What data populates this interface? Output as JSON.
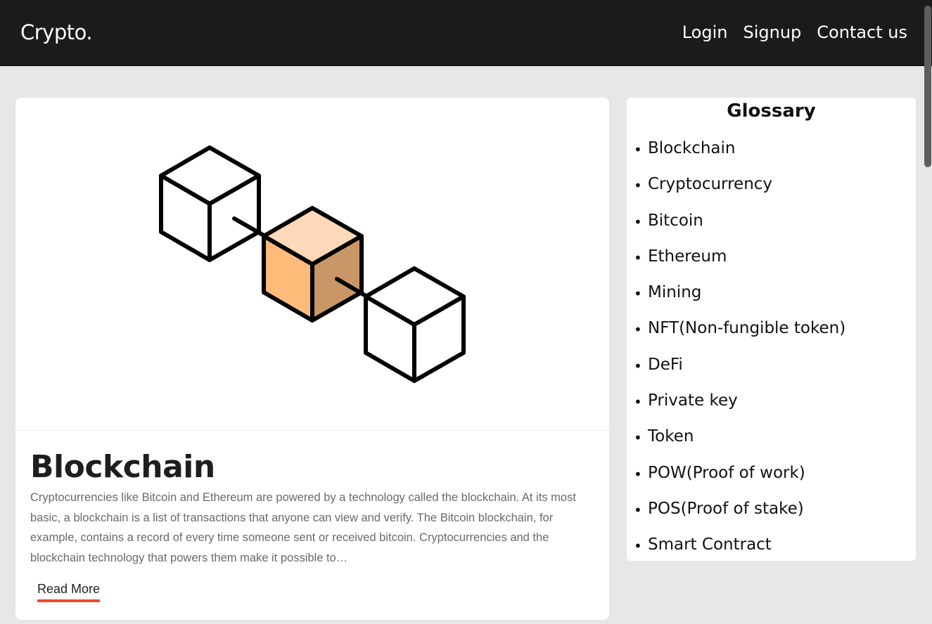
{
  "nav": {
    "brand": "Crypto.",
    "links": [
      "Login",
      "Signup",
      "Contact us"
    ]
  },
  "card": {
    "title": "Blockchain",
    "text": "Cryptocurrencies like Bitcoin and Ethereum are powered by a technology called the blockchain. At its most basic, a blockchain is a list of transactions that anyone can view and verify. The Bitcoin blockchain, for example, contains a record of every time someone sent or received bitcoin. Cryptocurrencies and the blockchain technology that powers them make it possible to…",
    "read_more": "Read More",
    "image_icon": "blockchain-cubes-icon"
  },
  "glossary": {
    "title": "Glossary",
    "items": [
      "Blockchain",
      "Cryptocurrency",
      "Bitcoin",
      "Ethereum",
      "Mining",
      "NFT(Non-fungible token)",
      "DeFi",
      "Private key",
      "Token",
      "POW(Proof of work)",
      "POS(Proof of stake)",
      "Smart Contract"
    ]
  },
  "colors": {
    "navbar": "#1b1b1b",
    "background": "#e7e7e7",
    "accent_underline": "#f2482f",
    "cube_top": "#fdd9b9",
    "cube_left": "#febb7a",
    "cube_right": "#c99767"
  }
}
